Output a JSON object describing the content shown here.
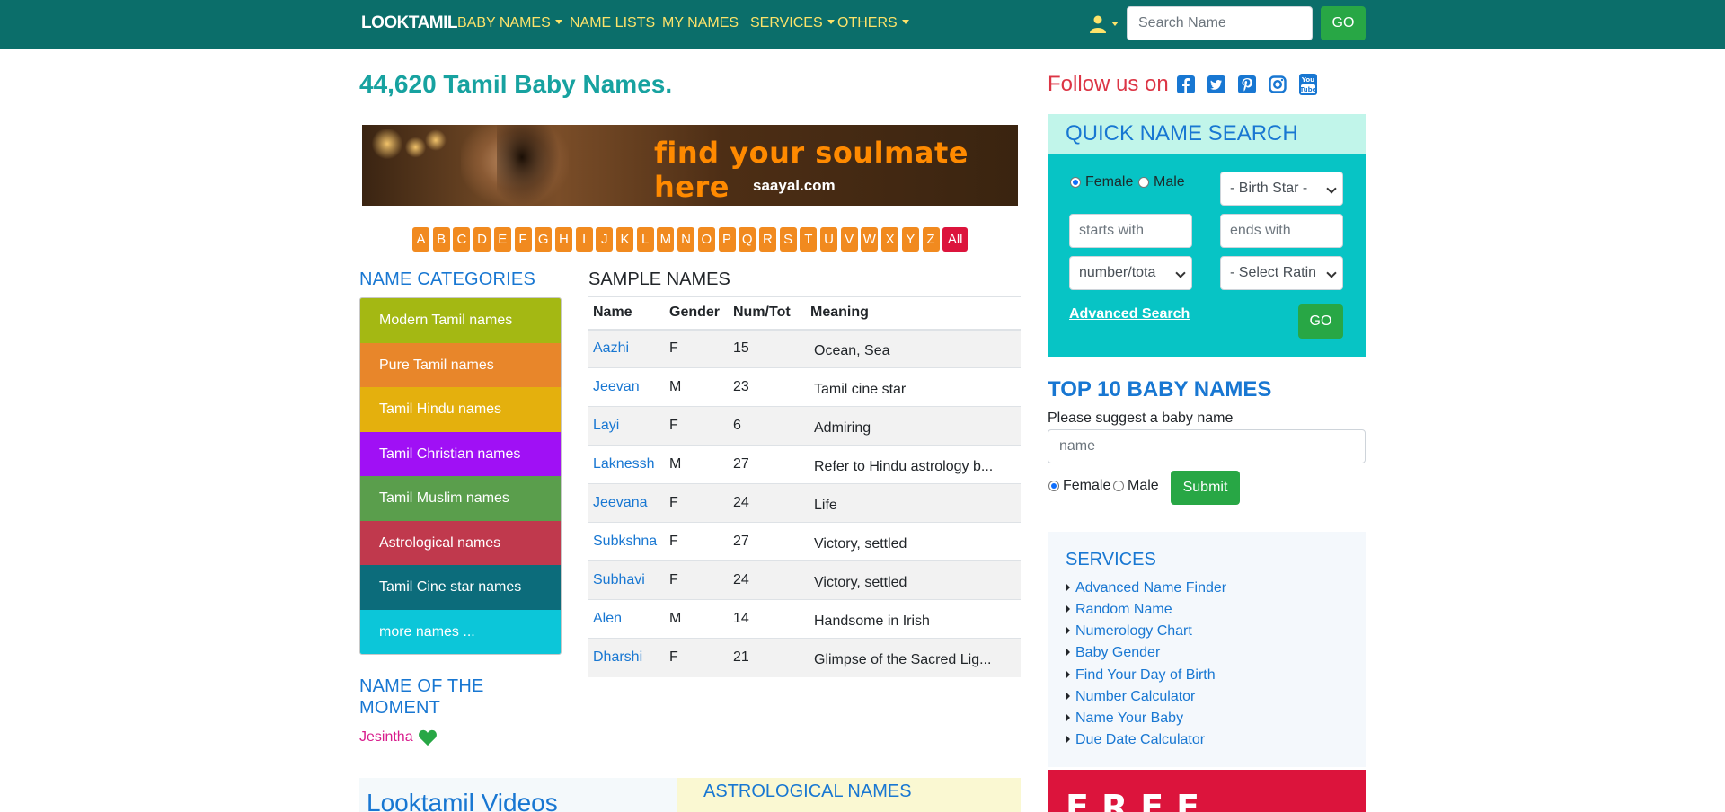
{
  "navbar": {
    "brand": "LOOKTAMIL",
    "items": [
      {
        "label": "BABY NAMES",
        "dropdown": true
      },
      {
        "label": "NAME LISTS",
        "dropdown": false
      },
      {
        "label": "MY NAMES",
        "dropdown": false
      },
      {
        "label": "SERVICES",
        "dropdown": true
      },
      {
        "label": "OTHERS",
        "dropdown": true
      }
    ],
    "user_icon": "user-icon",
    "search_placeholder": "Search Name",
    "search_button": "GO",
    "accent_color": "#fde36a",
    "bg_color": "#0b6e6a"
  },
  "main": {
    "title": "44,620 Tamil Baby Names.",
    "banner": {
      "tagline": "find your soulmate here",
      "site": "saayal.com"
    },
    "alphabet": [
      "A",
      "B",
      "C",
      "D",
      "E",
      "F",
      "G",
      "H",
      "I",
      "J",
      "K",
      "L",
      "M",
      "N",
      "O",
      "P",
      "Q",
      "R",
      "S",
      "T",
      "U",
      "V",
      "W",
      "X",
      "Y",
      "Z"
    ],
    "alphabet_all": "All",
    "categories_heading": "NAME CATEGORIES",
    "categories": [
      {
        "label": "Modern Tamil names",
        "color": "#a4b813"
      },
      {
        "label": "Pure Tamil names",
        "color": "#e8862a"
      },
      {
        "label": "Tamil Hindu names",
        "color": "#e4b00d"
      },
      {
        "label": "Tamil Christian names",
        "color": "#a010f5"
      },
      {
        "label": "Tamil Muslim names",
        "color": "#5a9e4c"
      },
      {
        "label": "Astrological names",
        "color": "#c0394d"
      },
      {
        "label": "Tamil Cine star names",
        "color": "#0c6c7b"
      },
      {
        "label": "more names ...",
        "color": "#0cc6d9"
      }
    ],
    "moment_heading_1": "NAME OF THE",
    "moment_heading_2": "MOMENT",
    "moment_name": "Jesintha",
    "sample_heading": "SAMPLE NAMES",
    "table": {
      "headers": [
        "Name",
        "Gender",
        "Num/Tot",
        "Meaning"
      ],
      "rows": [
        [
          "Aazhi",
          "F",
          "15",
          "Ocean, Sea"
        ],
        [
          "Jeevan",
          "M",
          "23",
          "Tamil cine star"
        ],
        [
          "Layi",
          "F",
          "6",
          "Admiring"
        ],
        [
          "Laknessh",
          "M",
          "27",
          "Refer to Hindu astrology b..."
        ],
        [
          "Jeevana",
          "F",
          "24",
          "Life"
        ],
        [
          "Subkshna",
          "F",
          "27",
          "Victory, settled"
        ],
        [
          "Subhavi",
          "F",
          "24",
          "Victory, settled"
        ],
        [
          "Alen",
          "M",
          "14",
          "Handsome in Irish"
        ],
        [
          "Dharshi",
          "F",
          "21",
          "Glimpse of the Sacred Lig..."
        ]
      ]
    },
    "videos_title": "Looktamil Videos",
    "astro_title": "ASTROLOGICAL NAMES"
  },
  "sidebar": {
    "follow_text": "Follow us on",
    "social_icons": [
      "facebook-icon",
      "twitter-icon",
      "pinterest-icon",
      "instagram-icon",
      "youtube-icon"
    ],
    "quick_search": {
      "title": "QUICK NAME SEARCH",
      "female_label": "Female",
      "male_label": "Male",
      "birth_star": "- Birth Star -",
      "starts_with_placeholder": "starts with",
      "ends_with_placeholder": "ends with",
      "number_select": "number/tota",
      "rating_select": "- Select Ratin",
      "advanced_link": "Advanced Search",
      "go_button": "GO"
    },
    "top10": {
      "title": "TOP 10 BABY NAMES",
      "subtitle": "Please suggest a baby name",
      "input_placeholder": "name",
      "female_label": "Female",
      "male_label": "Male",
      "submit": "Submit"
    },
    "services": {
      "title": "SERVICES",
      "items": [
        "Advanced Name Finder",
        "Random Name",
        "Numerology Chart",
        "Baby Gender",
        "Find Your Day of Birth",
        "Number Calculator",
        "Name Your Baby",
        "Due Date Calculator"
      ]
    },
    "free_text": "FREE"
  }
}
